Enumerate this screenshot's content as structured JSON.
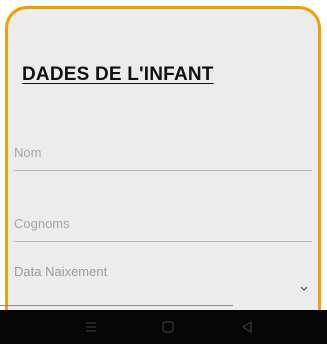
{
  "form": {
    "title": "DADES DE L'INFANT",
    "fields": {
      "nom": {
        "placeholder": "Nom",
        "value": ""
      },
      "cognoms": {
        "placeholder": "Cognoms",
        "value": ""
      },
      "data_naixement": {
        "label": "Data Naixement",
        "value": ""
      }
    }
  },
  "icons": {
    "dropdown": "chevron-down-icon",
    "nav_recents": "recents-icon",
    "nav_home": "home-icon",
    "nav_back": "back-icon"
  },
  "colors": {
    "card_border": "#f0a000",
    "card_background": "#ececec",
    "navbar_background": "#050505"
  }
}
